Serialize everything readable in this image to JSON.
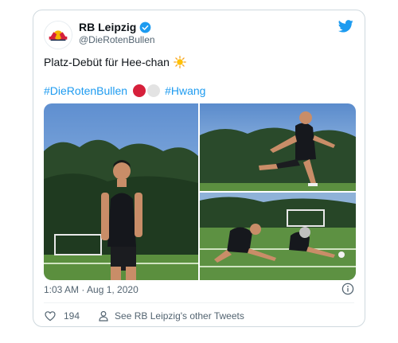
{
  "tweet": {
    "display_name": "RB Leipzig",
    "handle": "@DieRotenBullen",
    "text": "Platz-Debüt für Hee-chan",
    "hashtag_1": "#DieRotenBullen",
    "hashtag_2": "#Hwang",
    "timestamp": "1:03 AM · Aug 1, 2020",
    "like_count": "194",
    "other_tweets_label": "See RB Leipzig's other Tweets"
  },
  "icons": {
    "verified": "verified-badge-icon",
    "twitter": "twitter-bird-icon",
    "sun": "sun-emoji-icon",
    "info": "info-icon",
    "heart": "heart-icon",
    "person": "person-icon"
  },
  "colors": {
    "accent": "#1d9bf0",
    "text": "#0f1419",
    "muted": "#536471",
    "border": "#cfd9de",
    "brand_red": "#d6203b"
  }
}
